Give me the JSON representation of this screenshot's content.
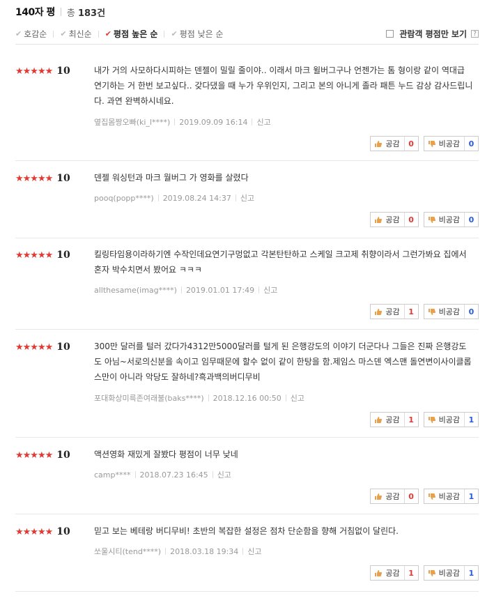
{
  "header": {
    "title": "140자 평",
    "total_prefix": "총",
    "total_count": "183",
    "total_suffix": "건"
  },
  "sort": {
    "options": [
      {
        "label": "호감순",
        "active": false
      },
      {
        "label": "최신순",
        "active": false
      },
      {
        "label": "평점 높은 순",
        "active": true
      },
      {
        "label": "평점 낮은 순",
        "active": false
      }
    ],
    "viewer_only_label": "관람객 평점만 보기",
    "help_glyph": "?"
  },
  "common": {
    "stars": "★★★★★",
    "agree_label": "공감",
    "disagree_label": "비공감",
    "report_label": "신고"
  },
  "reviews": [
    {
      "score": "10",
      "text": "내가 거의 사모하다시피하는 덴젤이 밀릴 줄이야.. 이래서 마크 윌버그구나 언젠가는 톰 형이랑 같이 역대급 연기하는 거 한번 보고싶다.. 갖다댔을 때 누가 우위인지, 그리고 본의 아니게 졸라 패튼 누드 감상 감사드립니다. 과연 완벽하시네요.",
      "user": "옆집몸짱오빠(ki_l****)",
      "date": "2019.09.09 16:14",
      "agree": "0",
      "disagree": "0"
    },
    {
      "score": "10",
      "text": "덴젤 워싱턴과 마크 월버그 가 영화를 살렸다",
      "user": "pooq(popp****)",
      "date": "2019.08.24 14:37",
      "agree": "0",
      "disagree": "0"
    },
    {
      "score": "10",
      "text": "킬링타임용이라하기엔 수작인데요연기구멍없고 각본탄탄하고 스케일 크고제 취향이라서 그런가봐요 집에서 혼자 박수치면서 봤어요 ㅋㅋㅋ",
      "user": "allthesame(imag****)",
      "date": "2019.01.01 17:49",
      "agree": "1",
      "disagree": "0"
    },
    {
      "score": "10",
      "text": "300만 달러를 털러 갔다가4312만5000달러를 털게 된 은행강도의 이야기 더군다나 그들은 진짜 은행강도도 아님~서로의신분을 속이고 임무때문에 할수 없이 같이 한탕을 함.제임스 마스덴 엑스맨 돌연변이사이클롭스만이 아니라 악당도 잘하네?흑과백의버디무비",
      "user": "포대화상미륵존여래불(baks****)",
      "date": "2018.12.16 00:50",
      "agree": "1",
      "disagree": "1"
    },
    {
      "score": "10",
      "text": "액션영화 재밌게 잘봤다 평점이 너무 낮네",
      "user": "camp****",
      "date": "2018.07.23 16:45",
      "agree": "0",
      "disagree": "1"
    },
    {
      "score": "10",
      "text": "믿고 보는 베테랑 버디무비! 초반의 복잡한 설정은 점차 단순함을 향해 거침없이 달린다.",
      "user": "쏘울시티(tend****)",
      "date": "2018.03.18 19:34",
      "agree": "1",
      "disagree": "1"
    }
  ]
}
